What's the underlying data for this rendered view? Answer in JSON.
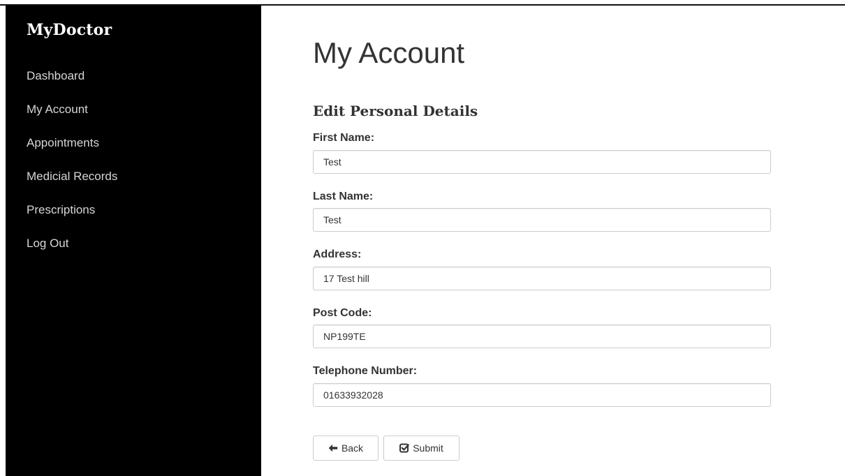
{
  "sidebar": {
    "brand": "MyDoctor",
    "items": [
      {
        "label": "Dashboard"
      },
      {
        "label": "My Account"
      },
      {
        "label": "Appointments"
      },
      {
        "label": "Medicial Records"
      },
      {
        "label": "Prescriptions"
      },
      {
        "label": "Log Out"
      }
    ]
  },
  "main": {
    "title": "My Account",
    "section_title": "Edit Personal Details",
    "fields": {
      "first_name": {
        "label": "First Name:",
        "value": "Test"
      },
      "last_name": {
        "label": "Last Name:",
        "value": "Test"
      },
      "address": {
        "label": "Address:",
        "value": "17 Test hill"
      },
      "post_code": {
        "label": "Post Code:",
        "value": "NP199TE"
      },
      "telephone": {
        "label": "Telephone Number:",
        "value": "01633932028"
      }
    },
    "buttons": {
      "back": {
        "label": "Back",
        "icon": "arrow-left-icon"
      },
      "submit": {
        "label": "Submit",
        "icon": "check-square-icon"
      }
    }
  },
  "colors": {
    "sidebar_bg": "#000000",
    "sidebar_text": "#d6d6d6",
    "brand_text": "#ffffff",
    "text": "#333333",
    "input_border": "#cccccc"
  }
}
